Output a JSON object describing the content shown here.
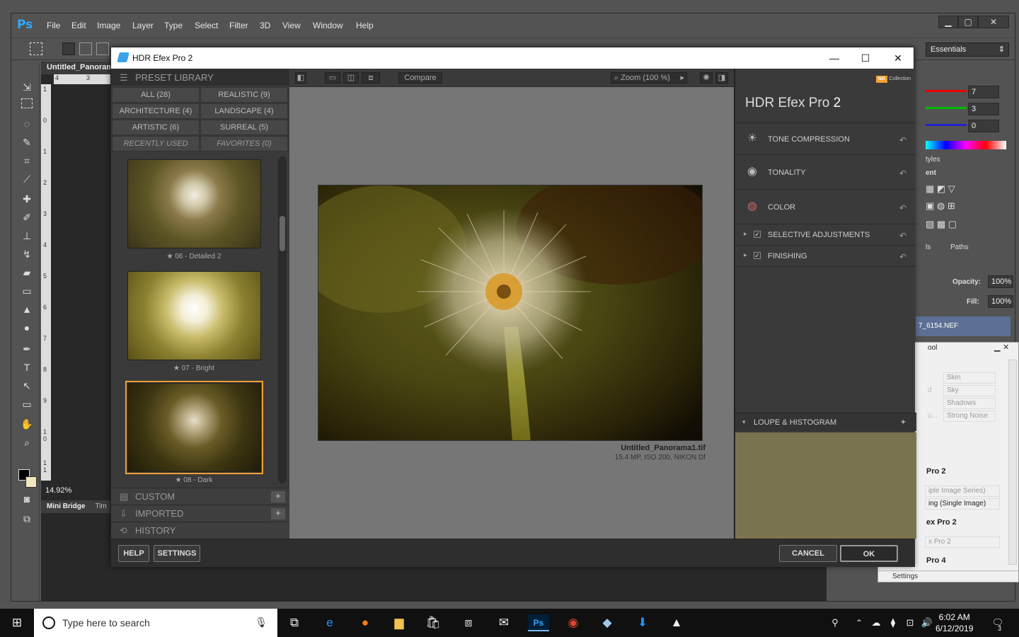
{
  "ps": {
    "logo": "Ps",
    "menu": [
      "File",
      "Edit",
      "Image",
      "Layer",
      "Type",
      "Select",
      "Filter",
      "3D",
      "View",
      "Window",
      "Help"
    ],
    "workspace": "Essentials",
    "doc_tab": "Untitled_Panoram",
    "zoom": "14.92%",
    "mini_bridge": "Mini Bridge",
    "timeline_abbrev": "Tim",
    "ruler_h": [
      "4",
      "3"
    ],
    "ruler_v": [
      "1",
      "0",
      "1",
      "2",
      "3",
      "4",
      "5",
      "6",
      "7",
      "8",
      "9",
      "1\n0",
      "1\n1"
    ],
    "color_values": [
      "7",
      "3",
      "0"
    ],
    "styles_tab": "tyles",
    "adjustments_tab": "ent",
    "channels_tab": "ls",
    "paths_tab": "Paths",
    "opacity_label": "Opacity:",
    "opacity_value": "100%",
    "fill_label": "Fill:",
    "fill_value": "100%",
    "layer_name": "7_6154.NEF",
    "selective_tool_title": "ool",
    "selective_items": [
      "Skin",
      "Sky",
      "Shadows",
      "Strong Noise"
    ],
    "selective_partial": [
      "d",
      "u..."
    ],
    "hdr2_header": "Pro 2",
    "hdr2_items": [
      "iple Image Series)",
      "ing (Single Image)"
    ],
    "hdr2_header_b": "ex Pro 2",
    "hdr2_item_b": "x Pro 2",
    "pro4_header": "Pro 4",
    "settings": "Settings"
  },
  "dialog": {
    "title": "HDR Efex Pro 2",
    "library": {
      "header": "PRESET LIBRARY",
      "categories": [
        {
          "label": "ALL (28)"
        },
        {
          "label": "REALISTIC (9)"
        },
        {
          "label": "ARCHITECTURE (4)"
        },
        {
          "label": "LANDSCAPE (4)"
        },
        {
          "label": "ARTISTIC (6)"
        },
        {
          "label": "SURREAL (5)"
        },
        {
          "label": "RECENTLY USED"
        },
        {
          "label": "FAVORITES (0)"
        }
      ],
      "presets": [
        {
          "label": "★ 06 - Detailed 2",
          "selected": false
        },
        {
          "label": "★ 07 - Bright",
          "selected": false
        },
        {
          "label": "★ 08 - Dark",
          "selected": true
        }
      ],
      "custom": "CUSTOM",
      "imported": "IMPORTED",
      "history": "HISTORY"
    },
    "toolbar": {
      "compare": "Compare",
      "zoom": "Zoom (100 %)"
    },
    "preview": {
      "filename": "Untitled_Panorama1.tif",
      "info": "15.4 MP, ISO 200, NIKON Df"
    },
    "right": {
      "brand_badge": "NIK",
      "brand_text": "Collection",
      "product": "HDR Efex Pro",
      "version": "2",
      "sections": [
        {
          "label": "TONE COMPRESSION",
          "icon": "sun-icon"
        },
        {
          "label": "TONALITY",
          "icon": "aperture-icon"
        },
        {
          "label": "COLOR",
          "icon": "color-wheel-icon"
        }
      ],
      "selective": "SELECTIVE ADJUSTMENTS",
      "finishing": "FINISHING",
      "loupe": "LOUPE & HISTOGRAM"
    },
    "buttons": {
      "help": "HELP",
      "settings": "SETTINGS",
      "cancel": "CANCEL",
      "ok": "OK"
    }
  },
  "taskbar": {
    "search_placeholder": "Type here to search",
    "time": "6:02 AM",
    "date": "6/12/2019",
    "notification_count": "3"
  }
}
